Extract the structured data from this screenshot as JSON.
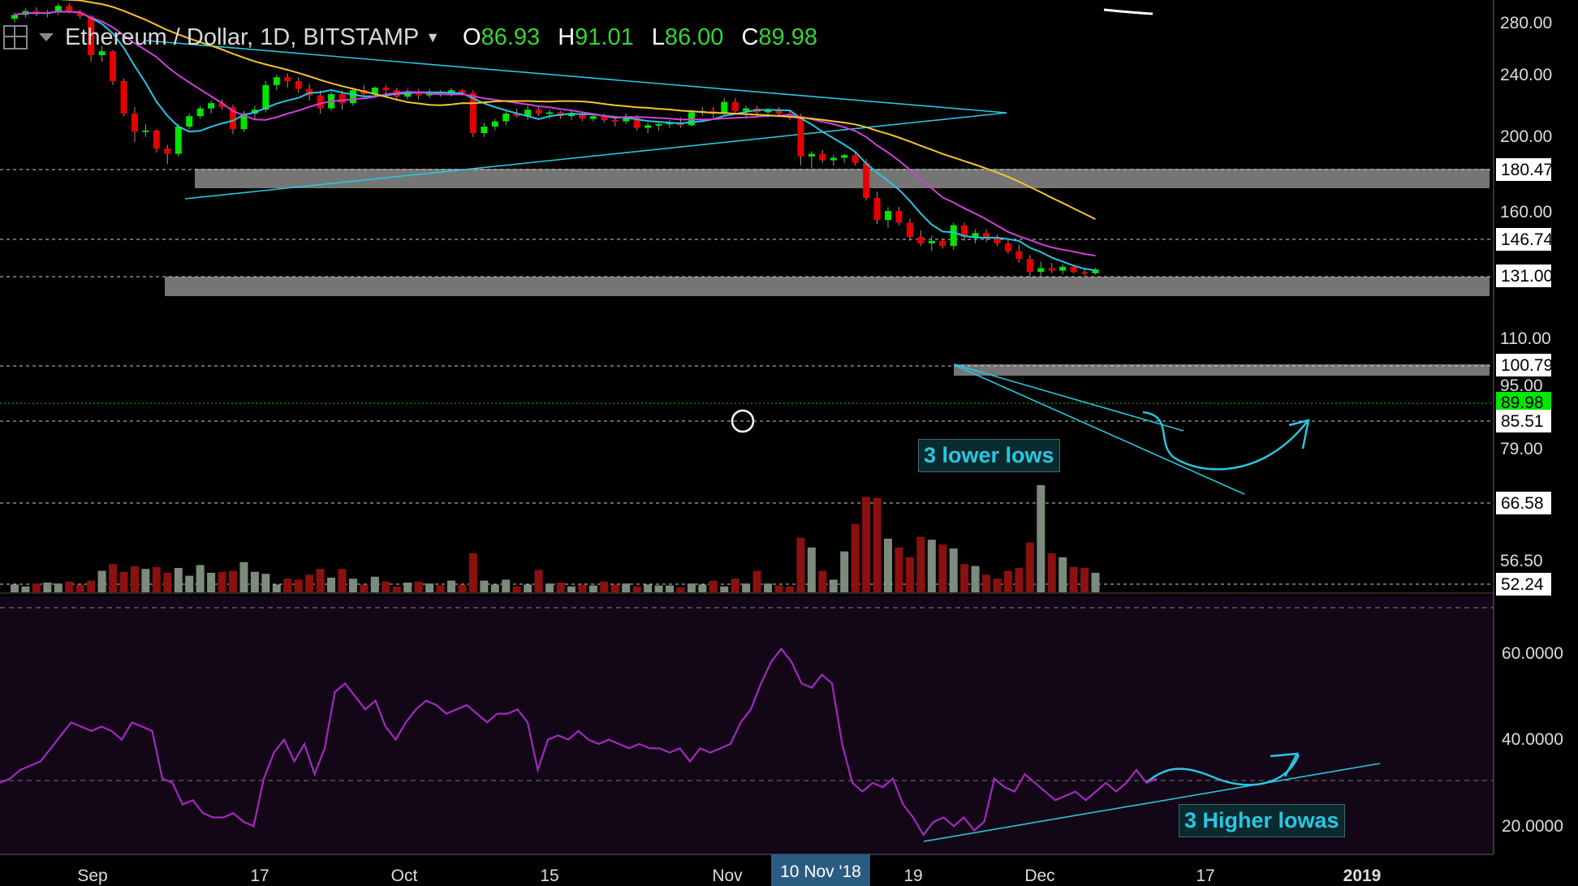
{
  "header": {
    "symbol": "Ethereum / Dollar, 1D, BITSTAMP",
    "open_label": "O",
    "open_value": "86.93",
    "high_label": "H",
    "high_value": "91.01",
    "low_label": "L",
    "low_value": "86.00",
    "close_label": "C",
    "close_value": "89.98"
  },
  "annotations": {
    "lower_lows": "3 lower lows",
    "higher_lows": "3 Higher lowas"
  },
  "x_axis": {
    "ticks": [
      "Sep",
      "17",
      "Oct",
      "15",
      "Nov",
      "19",
      "Dec",
      "17",
      "2019"
    ],
    "highlight": "10 Nov '18"
  },
  "price_axis": {
    "ticks": [
      "280.00",
      "240.00",
      "200.00",
      "160.00",
      "110.00",
      "95.00",
      "79.00",
      "56.50"
    ],
    "levels": [
      "180.47",
      "146.74",
      "131.00",
      "100.79",
      "85.51",
      "66.58",
      "52.24"
    ],
    "current": "89.98"
  },
  "rsi_axis": {
    "ticks": [
      "60.0000",
      "40.0000",
      "20.0000"
    ]
  },
  "colors": {
    "up": "#00e600",
    "down": "#e60000",
    "vol_up": "#7d8b7d",
    "vol_down": "#8b1010",
    "ma_fast": "#27c6e0",
    "ma_mid": "#d040d8",
    "ma_slow": "#f4c52c",
    "trend": "#27c6e0",
    "rsi": "#a22ac0",
    "rsi_bg": "#130616"
  },
  "chart_data": [
    {
      "type": "candlestick",
      "title": "Ethereum / Dollar, 1D, BITSTAMP",
      "x_range": [
        "2018-08-26",
        "2019-01-02"
      ],
      "ylim": [
        50,
        290
      ],
      "candles": [
        [
          283,
          288,
          280,
          286
        ],
        [
          286,
          291,
          284,
          289
        ],
        [
          289,
          292,
          285,
          287
        ],
        [
          287,
          290,
          284,
          288
        ],
        [
          288,
          295,
          286,
          293
        ],
        [
          293,
          295,
          287,
          288
        ],
        [
          288,
          290,
          283,
          285
        ],
        [
          285,
          286,
          250,
          255
        ],
        [
          255,
          262,
          250,
          258
        ],
        [
          258,
          259,
          232,
          235
        ],
        [
          235,
          237,
          208,
          210
        ],
        [
          210,
          215,
          188,
          196
        ],
        [
          196,
          202,
          192,
          197
        ],
        [
          197,
          198,
          180,
          183
        ],
        [
          183,
          186,
          171,
          179
        ],
        [
          179,
          202,
          177,
          200
        ],
        [
          200,
          210,
          198,
          208
        ],
        [
          208,
          216,
          206,
          214
        ],
        [
          214,
          220,
          210,
          218
        ],
        [
          218,
          221,
          213,
          215
        ],
        [
          215,
          217,
          194,
          198
        ],
        [
          198,
          212,
          196,
          210
        ],
        [
          210,
          216,
          205,
          213
        ],
        [
          213,
          235,
          211,
          232
        ],
        [
          232,
          240,
          228,
          238
        ],
        [
          238,
          241,
          230,
          235
        ],
        [
          235,
          238,
          226,
          229
        ],
        [
          229,
          233,
          220,
          224
        ],
        [
          224,
          228,
          210,
          214
        ],
        [
          214,
          227,
          212,
          225
        ],
        [
          225,
          228,
          213,
          218
        ],
        [
          218,
          230,
          216,
          228
        ],
        [
          228,
          232,
          223,
          225
        ],
        [
          225,
          231,
          223,
          230
        ],
        [
          230,
          232,
          225,
          228
        ],
        [
          228,
          230,
          220,
          223
        ],
        [
          223,
          229,
          221,
          227
        ],
        [
          227,
          229,
          221,
          224
        ],
        [
          224,
          229,
          222,
          227
        ],
        [
          227,
          228,
          223,
          225
        ],
        [
          225,
          230,
          223,
          228
        ],
        [
          228,
          229,
          224,
          226
        ],
        [
          226,
          228,
          192,
          195
        ],
        [
          195,
          203,
          192,
          200
        ],
        [
          200,
          206,
          197,
          204
        ],
        [
          204,
          212,
          201,
          210
        ],
        [
          210,
          214,
          207,
          208
        ],
        [
          208,
          216,
          205,
          213
        ],
        [
          213,
          215,
          208,
          210
        ],
        [
          210,
          213,
          206,
          211
        ],
        [
          211,
          212,
          206,
          208
        ],
        [
          208,
          212,
          205,
          210
        ],
        [
          210,
          211,
          204,
          206
        ],
        [
          206,
          210,
          204,
          208
        ],
        [
          208,
          210,
          203,
          205
        ],
        [
          205,
          208,
          200,
          204
        ],
        [
          204,
          210,
          202,
          207
        ],
        [
          207,
          209,
          197,
          199
        ],
        [
          199,
          203,
          195,
          201
        ],
        [
          201,
          204,
          197,
          202
        ],
        [
          202,
          205,
          199,
          203
        ],
        [
          203,
          207,
          199,
          201
        ],
        [
          201,
          213,
          200,
          211
        ],
        [
          211,
          215,
          208,
          212
        ],
        [
          212,
          215,
          206,
          210
        ],
        [
          210,
          222,
          208,
          219
        ],
        [
          219,
          222,
          210,
          212
        ],
        [
          212,
          216,
          206,
          214
        ],
        [
          214,
          216,
          208,
          211
        ],
        [
          211,
          214,
          207,
          213
        ],
        [
          213,
          215,
          208,
          210
        ],
        [
          210,
          212,
          205,
          208
        ],
        [
          208,
          210,
          170,
          177
        ],
        [
          177,
          181,
          168,
          179
        ],
        [
          179,
          182,
          172,
          174
        ],
        [
          174,
          178,
          170,
          176
        ],
        [
          176,
          179,
          172,
          178
        ],
        [
          178,
          181,
          170,
          172
        ],
        [
          172,
          175,
          143,
          145
        ],
        [
          145,
          150,
          125,
          128
        ],
        [
          128,
          138,
          122,
          135
        ],
        [
          135,
          138,
          124,
          126
        ],
        [
          126,
          129,
          112,
          115
        ],
        [
          115,
          120,
          108,
          110
        ],
        [
          110,
          116,
          104,
          112
        ],
        [
          112,
          114,
          106,
          108
        ],
        [
          108,
          126,
          105,
          124
        ],
        [
          124,
          126,
          112,
          115
        ],
        [
          115,
          121,
          110,
          118
        ],
        [
          118,
          121,
          111,
          114
        ],
        [
          114,
          117,
          108,
          110
        ],
        [
          110,
          114,
          102,
          104
        ],
        [
          104,
          109,
          95,
          98
        ],
        [
          98,
          101,
          84,
          88
        ],
        [
          88,
          96,
          85,
          91
        ],
        [
          91,
          95,
          87,
          89
        ],
        [
          89,
          94,
          86,
          92
        ],
        [
          92,
          94,
          87,
          88
        ],
        [
          88,
          90,
          85,
          87
        ],
        [
          86.93,
          91.01,
          86,
          89.98
        ]
      ]
    },
    {
      "type": "bar",
      "title": "Volume",
      "values": [
        8,
        6,
        9,
        10,
        9,
        11,
        8,
        12,
        22,
        29,
        21,
        27,
        24,
        26,
        20,
        25,
        17,
        28,
        20,
        21,
        22,
        31,
        21,
        19,
        8,
        14,
        13,
        18,
        24,
        15,
        24,
        14,
        8,
        16,
        11,
        6,
        10,
        11,
        9,
        7,
        12,
        8,
        40,
        12,
        8,
        13,
        6,
        8,
        23,
        9,
        10,
        6,
        8,
        7,
        11,
        8,
        9,
        6,
        8,
        7,
        7,
        5,
        9,
        8,
        12,
        6,
        14,
        9,
        22,
        9,
        7,
        6,
        56,
        46,
        22,
        13,
        42,
        70,
        98,
        97,
        55,
        46,
        36,
        57,
        54,
        49,
        45,
        29,
        27,
        18,
        14,
        22,
        25,
        51,
        110,
        40,
        36,
        26,
        25,
        20
      ]
    },
    {
      "type": "line",
      "title": "RSI",
      "ylim": [
        15,
        68
      ],
      "values": [
        30,
        31,
        33,
        34,
        35,
        38,
        41,
        44,
        43,
        42,
        43,
        42,
        40,
        44,
        43,
        42,
        31,
        30,
        25,
        26,
        23,
        22,
        22,
        23,
        21,
        20,
        31,
        37,
        40,
        35,
        39,
        32,
        38,
        51,
        53,
        50,
        47,
        49,
        43,
        40,
        44,
        47,
        49,
        48,
        46,
        47,
        48,
        46,
        44,
        46,
        46,
        47,
        44,
        33,
        40,
        41,
        40,
        42,
        40,
        39,
        40,
        39,
        38,
        39,
        38,
        38,
        37,
        38,
        35,
        38,
        37,
        38,
        39,
        44,
        47,
        53,
        58,
        61,
        58,
        53,
        52,
        55,
        53,
        39,
        30,
        28,
        30,
        29,
        31,
        25,
        22,
        18,
        21,
        22,
        20,
        22,
        19,
        21,
        31,
        29,
        28,
        32,
        30,
        28,
        26,
        27,
        28,
        26,
        28,
        30,
        28,
        30,
        33,
        30,
        31
      ]
    }
  ]
}
